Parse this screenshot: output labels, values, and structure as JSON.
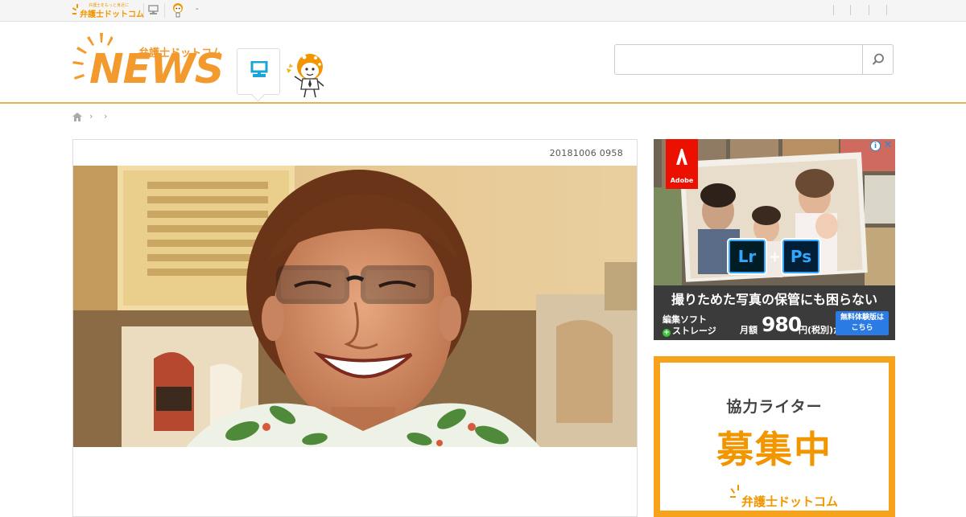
{
  "topbar": {
    "logo_text": "弁護士ドットコム",
    "logo_tagline": "弁護士をもっと身近に",
    "dash": "-"
  },
  "header": {
    "logo_jp": "弁護士ドットコム",
    "logo_news": "NEWS"
  },
  "search": {
    "value": "",
    "placeholder": ""
  },
  "article": {
    "date": "20181006 0958"
  },
  "ad": {
    "adobe_label": "Adobe",
    "lr": "Lr",
    "ps": "Ps",
    "plus": "+",
    "headline": "撮りためた写真の保管にも困らない",
    "line1": "編集ソフト",
    "line2": "ストレージ",
    "price_prefix": "月額",
    "price": "980",
    "price_suffix": "円(税別)から",
    "cta_line1": "無料体験版は",
    "cta_line2": "こちら",
    "info": "i",
    "close": "✕"
  },
  "writer_banner": {
    "line1": "協力ライター",
    "line2": "募集中",
    "logo": "弁護士ドットコム"
  },
  "colors": {
    "brand_orange": "#f29a2e",
    "header_rule": "#e4b24c",
    "banner_border": "#f7a21b",
    "accent_blue": "#1aa3d9"
  }
}
